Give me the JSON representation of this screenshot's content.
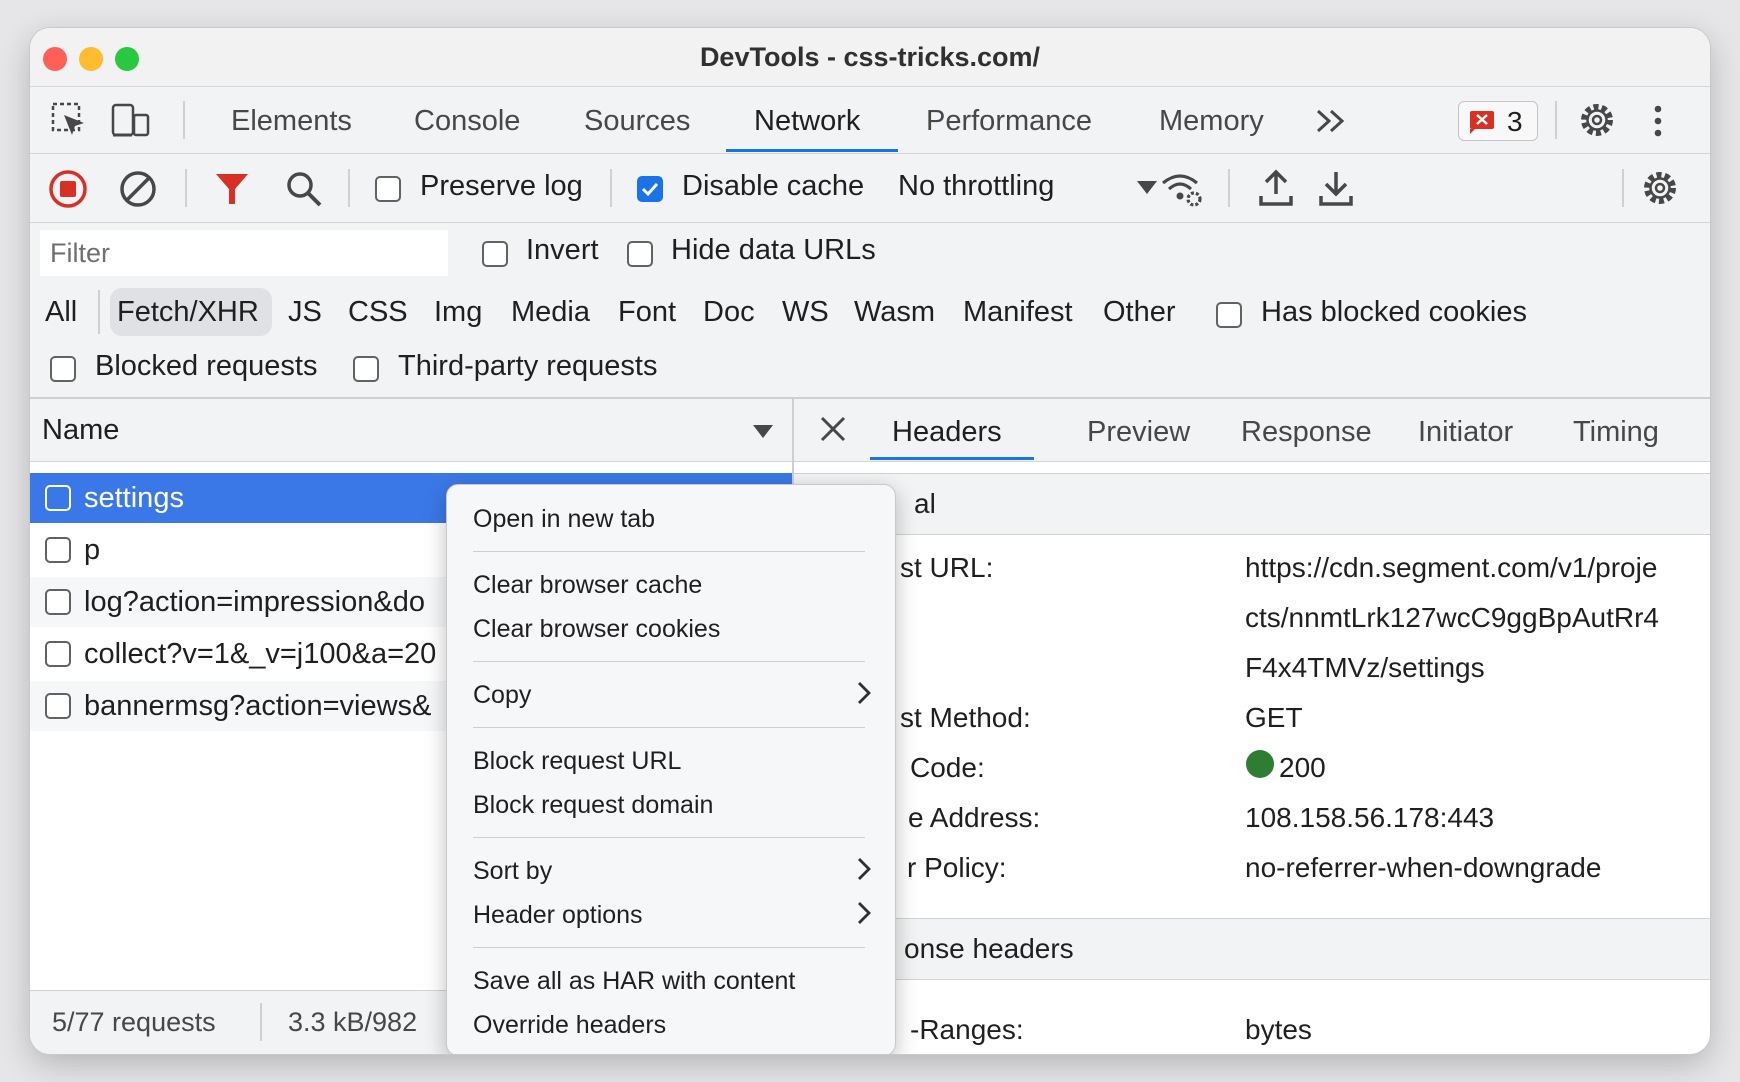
{
  "window": {
    "title": "DevTools - css-tricks.com/"
  },
  "tabs": [
    {
      "label": "Elements"
    },
    {
      "label": "Console"
    },
    {
      "label": "Sources"
    },
    {
      "label": "Network"
    },
    {
      "label": "Performance"
    },
    {
      "label": "Memory"
    }
  ],
  "active_tab": "Network",
  "issues_count": "3",
  "toolbar": {
    "preserve_log": "Preserve log",
    "preserve_log_checked": false,
    "disable_cache": "Disable cache",
    "disable_cache_checked": true,
    "throttling": "No throttling"
  },
  "filter": {
    "placeholder": "Filter",
    "invert": "Invert",
    "hide_data_urls": "Hide data URLs",
    "types": [
      "All",
      "Fetch/XHR",
      "JS",
      "CSS",
      "Img",
      "Media",
      "Font",
      "Doc",
      "WS",
      "Wasm",
      "Manifest",
      "Other"
    ],
    "selected_type": "Fetch/XHR",
    "has_blocked_cookies": "Has blocked cookies",
    "blocked_requests": "Blocked requests",
    "third_party": "Third-party requests"
  },
  "requests": {
    "column_name": "Name",
    "rows": [
      "settings",
      "p",
      "log?action=impression&do",
      "collect?v=1&_v=j100&a=20",
      "bannermsg?action=views&"
    ],
    "selected_row": "settings"
  },
  "status": {
    "requests": "5/77 requests",
    "transferred": "3.3 kB/982"
  },
  "detail": {
    "tabs": [
      "Headers",
      "Preview",
      "Response",
      "Initiator",
      "Timing"
    ],
    "active_tab": "Headers",
    "general_header": "al",
    "general": [
      {
        "key": "st URL:",
        "value_lines": [
          "https://cdn.segment.com/v1/proje",
          "cts/nnmtLrk127wcC9ggBpAutRr4",
          "F4x4TMVz/settings"
        ]
      },
      {
        "key": "st Method:",
        "value": "GET"
      },
      {
        "key": "Code:",
        "value": "200"
      },
      {
        "key": "e Address:",
        "value": "108.158.56.178:443"
      },
      {
        "key": "r Policy:",
        "value": "no-referrer-when-downgrade"
      }
    ],
    "response_header": "onse headers",
    "response": [
      {
        "key": "-Ranges:",
        "value": "bytes"
      }
    ],
    "status_color": "#2e7d32"
  },
  "context_menu": {
    "items": [
      "Open in new tab",
      "Clear browser cache",
      "Clear browser cookies",
      "Copy",
      "Block request URL",
      "Block request domain",
      "Sort by",
      "Header options",
      "Save all as HAR with content",
      "Override headers"
    ]
  },
  "colors": {
    "accent": "#1a73e8",
    "selected_row": "#3b78e7",
    "record_red": "#d93025"
  }
}
